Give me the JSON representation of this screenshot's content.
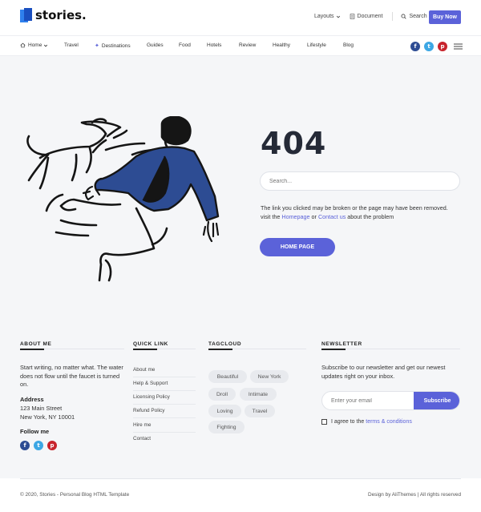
{
  "brand": {
    "name": "stories."
  },
  "header": {
    "layouts": "Layouts",
    "document": "Document",
    "search": "Search",
    "buy_now": "Buy Now"
  },
  "nav": {
    "items": [
      "Home",
      "Travel",
      "Destinations",
      "Guides",
      "Food",
      "Hotels",
      "Review",
      "Healthy",
      "Lifestyle",
      "Blog"
    ],
    "social": [
      "f",
      "t",
      "p"
    ]
  },
  "error": {
    "code": "404",
    "search_placeholder": "Search...",
    "line1": "The link you clicked may be broken or the page may have been removed.",
    "line2_pre": "visit the ",
    "homepage_link": "Homepage",
    "line2_mid": " or ",
    "contact_link": "Contact us",
    "line2_post": " about the problem",
    "home_button": "HOME PAGE"
  },
  "footer": {
    "about": {
      "heading": "ABOUT ME",
      "text": "Start writing, no matter what. The water does not flow until the faucet is turned on.",
      "address_label": "Address",
      "street": "123 Main Street",
      "city": "New York, NY 10001",
      "follow_label": "Follow me"
    },
    "quick_link": {
      "heading": "QUICK LINK",
      "items": [
        "About me",
        "Help & Support",
        "Licensing Policy",
        "Refund Policy",
        "Hire me",
        "Contact"
      ]
    },
    "tagcloud": {
      "heading": "TAGCLOUD",
      "tags": [
        "Beautiful",
        "New York",
        "Droll",
        "Intimate",
        "Loving",
        "Travel",
        "Fighting"
      ]
    },
    "newsletter": {
      "heading": "NEWSLETTER",
      "text": "Subscribe to our newsletter and get our newest updates right on your inbox.",
      "email_placeholder": "Enter your email",
      "subscribe": "Subscribe",
      "agree_pre": "I agree to the ",
      "agree_link": "terms & conditions"
    },
    "copyright": "© 2020, Stories - Personal Blog HTML Template",
    "credit": "Design by AliThemes | All rights reserved"
  },
  "colors": {
    "accent": "#5b62d9",
    "dark": "#252a37",
    "background": "#f5f6f8",
    "jacket": "#2d4c93"
  }
}
